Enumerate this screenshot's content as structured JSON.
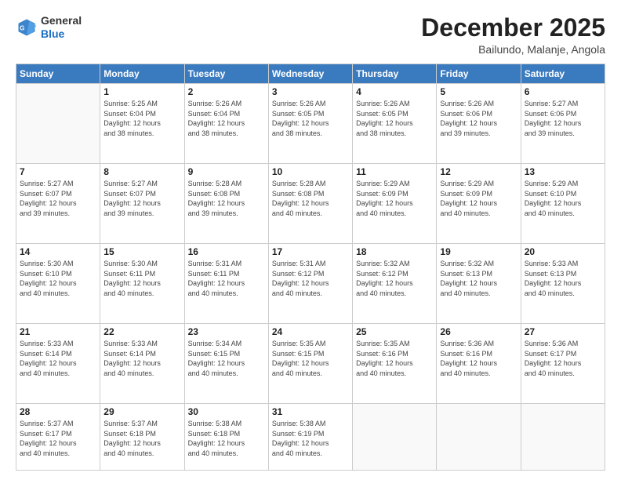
{
  "logo": {
    "general": "General",
    "blue": "Blue"
  },
  "header": {
    "month_year": "December 2025",
    "location": "Bailundo, Malanje, Angola"
  },
  "weekdays": [
    "Sunday",
    "Monday",
    "Tuesday",
    "Wednesday",
    "Thursday",
    "Friday",
    "Saturday"
  ],
  "weeks": [
    [
      {
        "day": "",
        "info": ""
      },
      {
        "day": "1",
        "info": "Sunrise: 5:25 AM\nSunset: 6:04 PM\nDaylight: 12 hours\nand 38 minutes."
      },
      {
        "day": "2",
        "info": "Sunrise: 5:26 AM\nSunset: 6:04 PM\nDaylight: 12 hours\nand 38 minutes."
      },
      {
        "day": "3",
        "info": "Sunrise: 5:26 AM\nSunset: 6:05 PM\nDaylight: 12 hours\nand 38 minutes."
      },
      {
        "day": "4",
        "info": "Sunrise: 5:26 AM\nSunset: 6:05 PM\nDaylight: 12 hours\nand 38 minutes."
      },
      {
        "day": "5",
        "info": "Sunrise: 5:26 AM\nSunset: 6:06 PM\nDaylight: 12 hours\nand 39 minutes."
      },
      {
        "day": "6",
        "info": "Sunrise: 5:27 AM\nSunset: 6:06 PM\nDaylight: 12 hours\nand 39 minutes."
      }
    ],
    [
      {
        "day": "7",
        "info": "Sunrise: 5:27 AM\nSunset: 6:07 PM\nDaylight: 12 hours\nand 39 minutes."
      },
      {
        "day": "8",
        "info": "Sunrise: 5:27 AM\nSunset: 6:07 PM\nDaylight: 12 hours\nand 39 minutes."
      },
      {
        "day": "9",
        "info": "Sunrise: 5:28 AM\nSunset: 6:08 PM\nDaylight: 12 hours\nand 39 minutes."
      },
      {
        "day": "10",
        "info": "Sunrise: 5:28 AM\nSunset: 6:08 PM\nDaylight: 12 hours\nand 40 minutes."
      },
      {
        "day": "11",
        "info": "Sunrise: 5:29 AM\nSunset: 6:09 PM\nDaylight: 12 hours\nand 40 minutes."
      },
      {
        "day": "12",
        "info": "Sunrise: 5:29 AM\nSunset: 6:09 PM\nDaylight: 12 hours\nand 40 minutes."
      },
      {
        "day": "13",
        "info": "Sunrise: 5:29 AM\nSunset: 6:10 PM\nDaylight: 12 hours\nand 40 minutes."
      }
    ],
    [
      {
        "day": "14",
        "info": "Sunrise: 5:30 AM\nSunset: 6:10 PM\nDaylight: 12 hours\nand 40 minutes."
      },
      {
        "day": "15",
        "info": "Sunrise: 5:30 AM\nSunset: 6:11 PM\nDaylight: 12 hours\nand 40 minutes."
      },
      {
        "day": "16",
        "info": "Sunrise: 5:31 AM\nSunset: 6:11 PM\nDaylight: 12 hours\nand 40 minutes."
      },
      {
        "day": "17",
        "info": "Sunrise: 5:31 AM\nSunset: 6:12 PM\nDaylight: 12 hours\nand 40 minutes."
      },
      {
        "day": "18",
        "info": "Sunrise: 5:32 AM\nSunset: 6:12 PM\nDaylight: 12 hours\nand 40 minutes."
      },
      {
        "day": "19",
        "info": "Sunrise: 5:32 AM\nSunset: 6:13 PM\nDaylight: 12 hours\nand 40 minutes."
      },
      {
        "day": "20",
        "info": "Sunrise: 5:33 AM\nSunset: 6:13 PM\nDaylight: 12 hours\nand 40 minutes."
      }
    ],
    [
      {
        "day": "21",
        "info": "Sunrise: 5:33 AM\nSunset: 6:14 PM\nDaylight: 12 hours\nand 40 minutes."
      },
      {
        "day": "22",
        "info": "Sunrise: 5:33 AM\nSunset: 6:14 PM\nDaylight: 12 hours\nand 40 minutes."
      },
      {
        "day": "23",
        "info": "Sunrise: 5:34 AM\nSunset: 6:15 PM\nDaylight: 12 hours\nand 40 minutes."
      },
      {
        "day": "24",
        "info": "Sunrise: 5:35 AM\nSunset: 6:15 PM\nDaylight: 12 hours\nand 40 minutes."
      },
      {
        "day": "25",
        "info": "Sunrise: 5:35 AM\nSunset: 6:16 PM\nDaylight: 12 hours\nand 40 minutes."
      },
      {
        "day": "26",
        "info": "Sunrise: 5:36 AM\nSunset: 6:16 PM\nDaylight: 12 hours\nand 40 minutes."
      },
      {
        "day": "27",
        "info": "Sunrise: 5:36 AM\nSunset: 6:17 PM\nDaylight: 12 hours\nand 40 minutes."
      }
    ],
    [
      {
        "day": "28",
        "info": "Sunrise: 5:37 AM\nSunset: 6:17 PM\nDaylight: 12 hours\nand 40 minutes."
      },
      {
        "day": "29",
        "info": "Sunrise: 5:37 AM\nSunset: 6:18 PM\nDaylight: 12 hours\nand 40 minutes."
      },
      {
        "day": "30",
        "info": "Sunrise: 5:38 AM\nSunset: 6:18 PM\nDaylight: 12 hours\nand 40 minutes."
      },
      {
        "day": "31",
        "info": "Sunrise: 5:38 AM\nSunset: 6:19 PM\nDaylight: 12 hours\nand 40 minutes."
      },
      {
        "day": "",
        "info": ""
      },
      {
        "day": "",
        "info": ""
      },
      {
        "day": "",
        "info": ""
      }
    ]
  ]
}
